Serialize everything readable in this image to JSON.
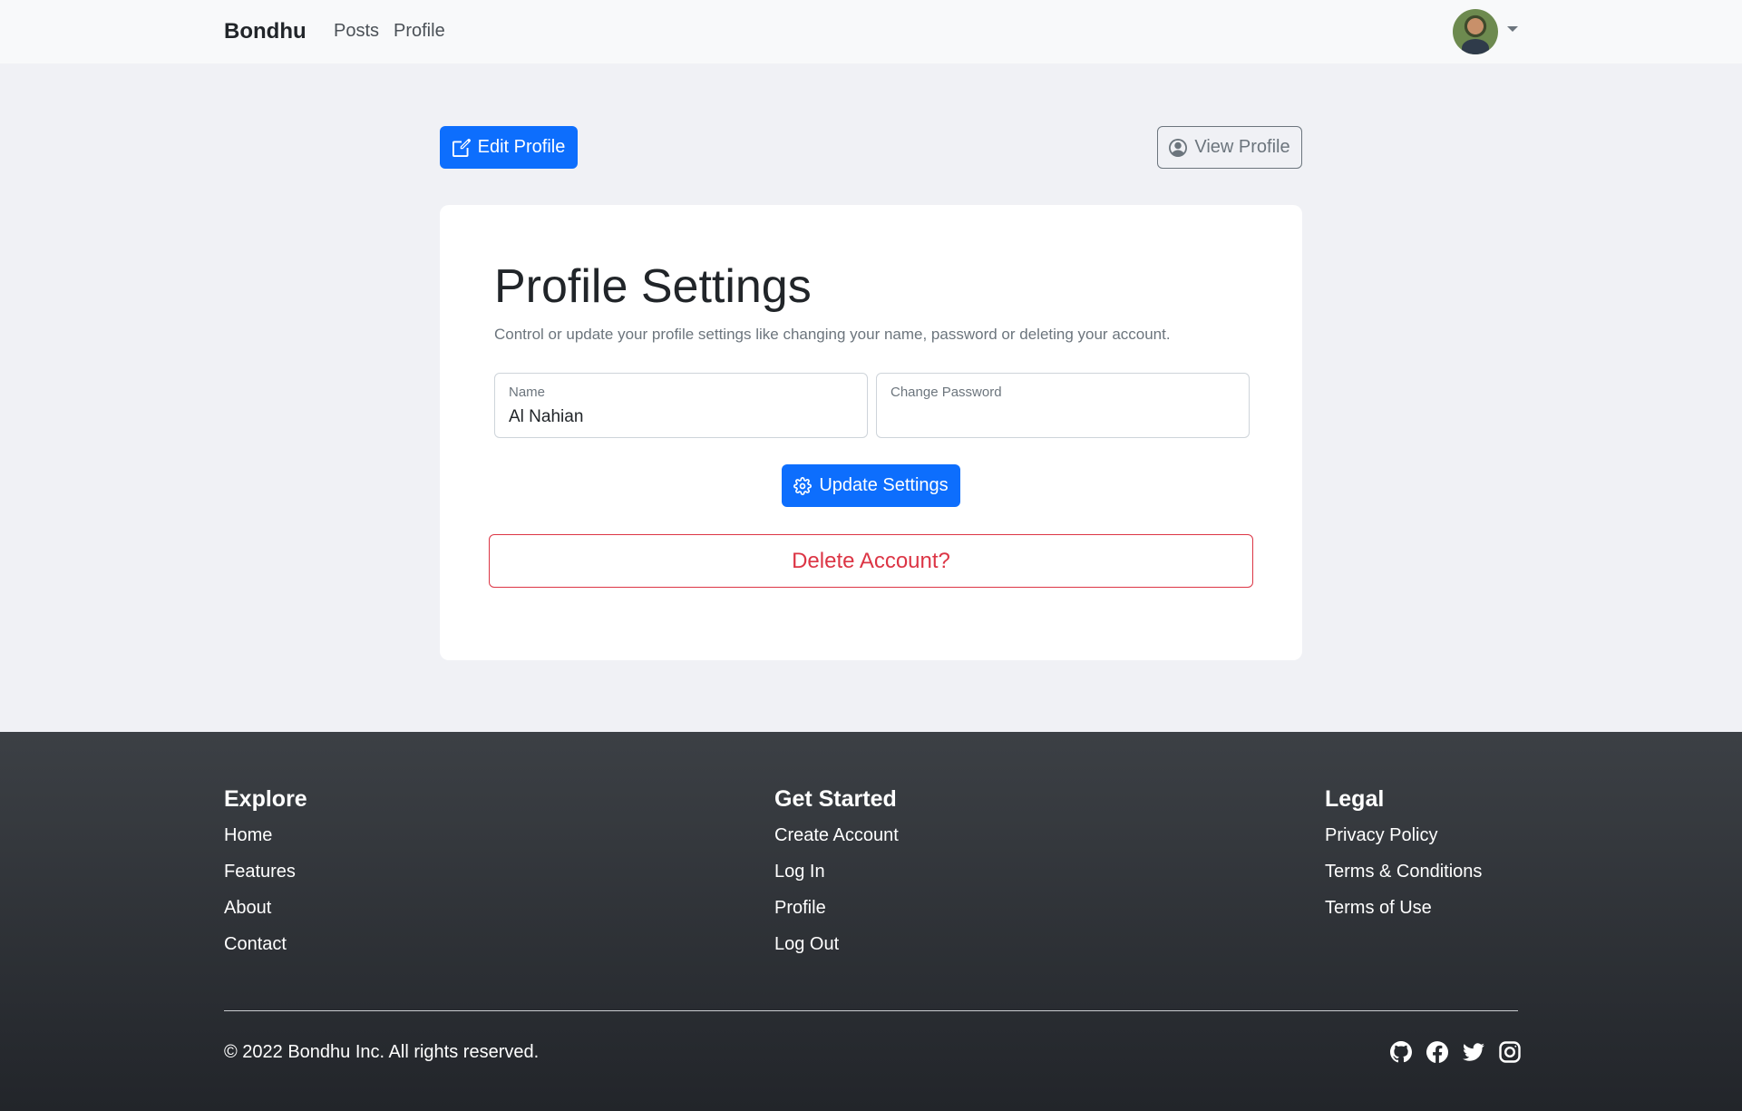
{
  "navbar": {
    "brand": "Bondhu",
    "links": [
      "Posts",
      "Profile"
    ]
  },
  "actions": {
    "edit_profile": "Edit Profile",
    "view_profile": "View Profile"
  },
  "settings": {
    "title": "Profile Settings",
    "description": "Control or update your profile settings like changing your name, password or deleting your account.",
    "name_label": "Name",
    "name_value": "Al Nahian",
    "password_label": "Change Password",
    "password_value": "",
    "update_label": "Update Settings",
    "delete_label": "Delete Account?"
  },
  "footer": {
    "columns": [
      {
        "heading": "Explore",
        "links": [
          "Home",
          "Features",
          "About",
          "Contact"
        ]
      },
      {
        "heading": "Get Started",
        "links": [
          "Create Account",
          "Log In",
          "Profile",
          "Log Out"
        ]
      },
      {
        "heading": "Legal",
        "links": [
          "Privacy Policy",
          "Terms & Conditions",
          "Terms of Use"
        ]
      }
    ],
    "copyright": "© 2022 Bondhu Inc. All rights reserved.",
    "social_icons": [
      "github-icon",
      "facebook-icon",
      "twitter-icon",
      "instagram-icon"
    ]
  },
  "colors": {
    "primary": "#0d6efd",
    "danger": "#dc3545",
    "secondary": "#6c757d"
  }
}
